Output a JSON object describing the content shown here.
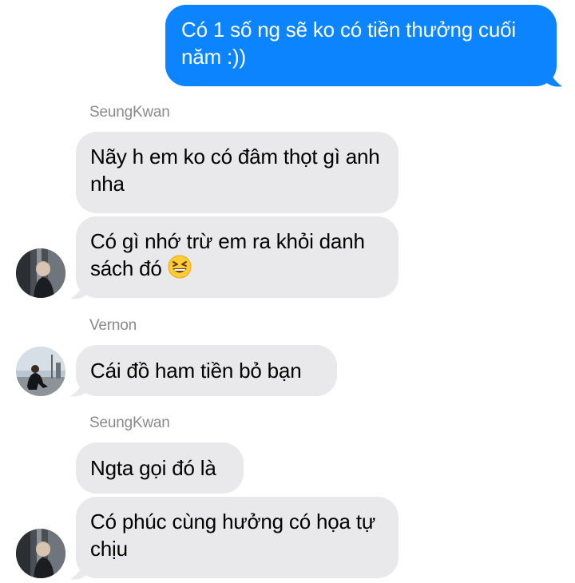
{
  "colors": {
    "outgoing_bubble": "#0b84fe",
    "incoming_bubble": "#e9e9eb",
    "sender_name": "#8a8a8e"
  },
  "messages": {
    "m1_text": "Có 1 số ng sẽ ko có tiền thưởng cuối năm :))",
    "seungkwan_name_1": "SeungKwan",
    "m2_text": "Nãy h em ko có đâm thọt gì anh nha",
    "m3_text": "Có gì nhớ trừ em ra khỏi danh sách đó",
    "m3_emoji": "grinning-squinting-face",
    "vernon_name": "Vernon",
    "m4_text": "Cái đồ ham tiền bỏ bạn",
    "seungkwan_name_2": "SeungKwan",
    "m5_text": "Ngta gọi đó là",
    "m6_text": "Có phúc cùng hưởng có họa tự chịu"
  },
  "avatars": {
    "seungkwan": "seungkwan-avatar",
    "vernon": "vernon-avatar"
  }
}
